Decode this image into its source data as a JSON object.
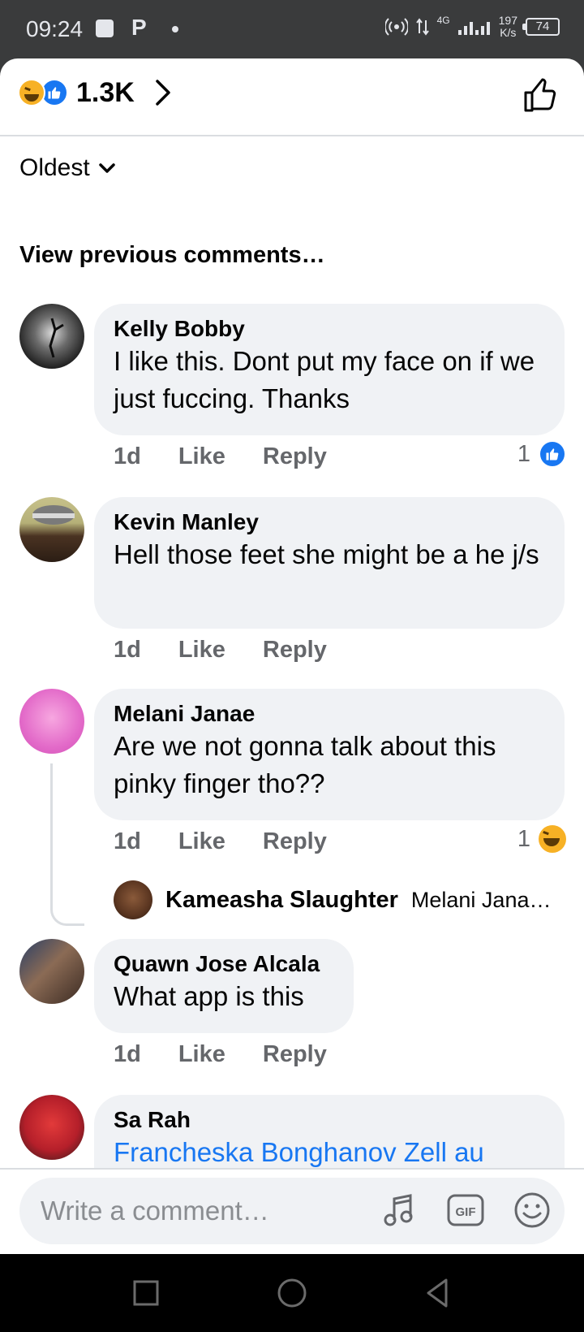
{
  "status_bar": {
    "time": "09:24",
    "p_icon": "P",
    "network": "4G",
    "speed_value": "197",
    "speed_unit": "K/s",
    "battery": "74"
  },
  "header": {
    "reaction_count": "1.3K",
    "reaction_icons": [
      "haha-icon",
      "like-icon"
    ]
  },
  "sort": {
    "label": "Oldest"
  },
  "view_previous": "View previous comments…",
  "comments": [
    {
      "author": "Kelly Bobby",
      "text": "I like this. Dont put my face on if we just fuccing. Thanks",
      "time": "1d",
      "like": "Like",
      "reply": "Reply",
      "reaction_count": "1",
      "reaction_type": "like"
    },
    {
      "author": "Kevin Manley",
      "text": "Hell those feet she might be a he j/s",
      "time": "1d",
      "like": "Like",
      "reply": "Reply"
    },
    {
      "author": "Melani Janae",
      "text": "Are we not gonna talk about this pinky finger tho??",
      "time": "1d",
      "like": "Like",
      "reply": "Reply",
      "reaction_count": "1",
      "reaction_type": "haha",
      "reply_preview": {
        "author": "Kameasha Slaughter",
        "snippet": "Melani Jana…"
      }
    },
    {
      "author": "Quawn Jose Alcala",
      "text": "What app is this",
      "time": "1d",
      "like": "Like",
      "reply": "Reply"
    },
    {
      "author": "Sa Rah",
      "text": "Francheska Bonghanov Zell au"
    }
  ],
  "composer": {
    "placeholder": "Write a comment…",
    "icons": [
      "music-icon",
      "gif-icon",
      "emoji-icon"
    ]
  },
  "colors": {
    "accent": "#1877f2",
    "bubble": "#f0f2f5",
    "muted": "#65676b",
    "haha": "#f7b125"
  }
}
